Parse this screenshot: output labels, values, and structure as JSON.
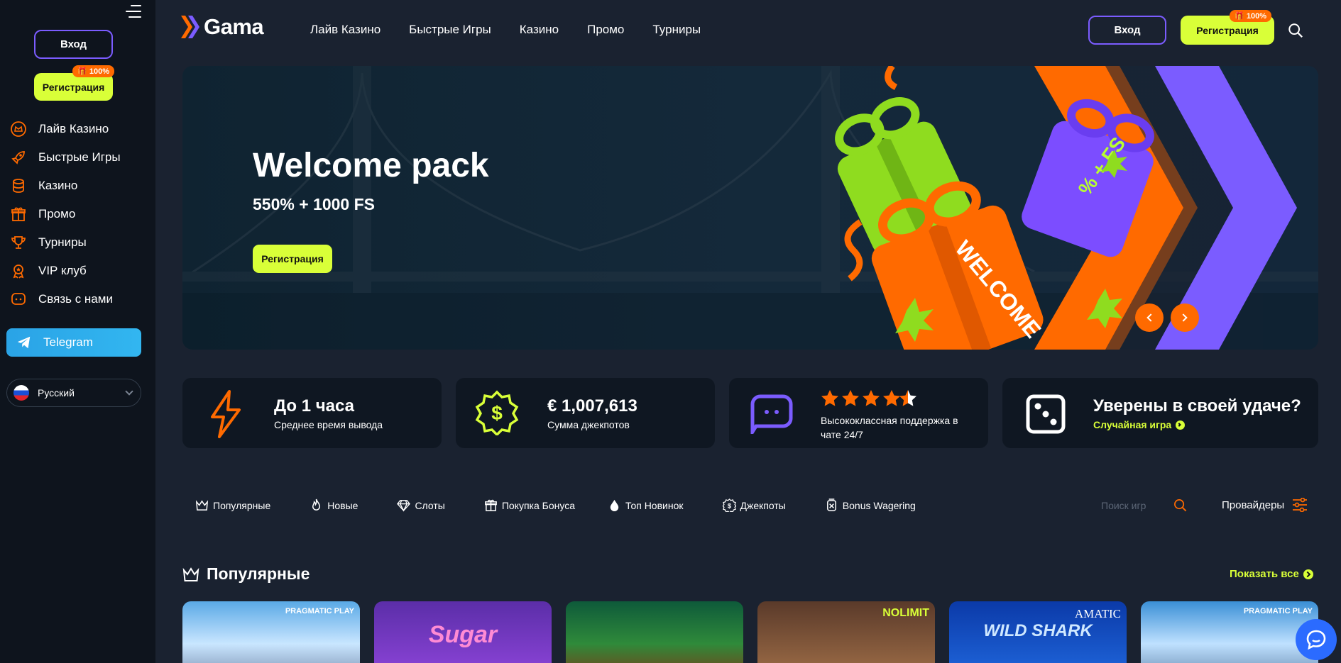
{
  "sidebar": {
    "login": "Вход",
    "register": "Регистрация",
    "register_badge": "🎁 100%",
    "items": [
      {
        "label": "Лайв Казино",
        "icon": "crown-circle-icon"
      },
      {
        "label": "Быстрые Игры",
        "icon": "rocket-icon"
      },
      {
        "label": "Казино",
        "icon": "coins-stack-icon"
      },
      {
        "label": "Промо",
        "icon": "gift-icon"
      },
      {
        "label": "Турниры",
        "icon": "trophy-icon"
      },
      {
        "label": "VIP клуб",
        "icon": "medal-icon"
      },
      {
        "label": "Связь с нами",
        "icon": "chat-icon"
      }
    ],
    "telegram": "Telegram",
    "language": "Русский"
  },
  "header": {
    "logo": "Gama",
    "nav": [
      "Лайв Казино",
      "Быстрые Игры",
      "Казино",
      "Промо",
      "Турниры"
    ],
    "login": "Вход",
    "register": "Регистрация",
    "register_badge": "🎁 100%"
  },
  "banner": {
    "title": "Welcome pack",
    "subtitle": "550% + 1000 FS",
    "button": "Регистрация",
    "gift_orange_text": "WELCOME",
    "gift_purple_text": "% + FS"
  },
  "cards": [
    {
      "title": "До 1 часа",
      "subtitle": "Среднее время вывода",
      "icon": "lightning-icon"
    },
    {
      "title": "€ 1,007,613",
      "subtitle": "Сумма джекпотов",
      "icon": "dollar-badge-icon"
    },
    {
      "rating": 4.5,
      "subtitle": "Высококлассная поддержка в чате 24/7",
      "icon": "chat-bubble-icon"
    },
    {
      "title": "Уверены в своей удаче?",
      "link": "Случайная игра",
      "icon": "dice-icon"
    }
  ],
  "filters": [
    {
      "label": "Популярные",
      "icon": "crown-icon"
    },
    {
      "label": "Новые",
      "icon": "flame-icon"
    },
    {
      "label": "Слоты",
      "icon": "diamond-icon"
    },
    {
      "label": "Покупка Бонуса",
      "icon": "gift-icon"
    },
    {
      "label": "Топ Новинок",
      "icon": "drop-icon"
    },
    {
      "label": "Джекпоты",
      "icon": "coin-icon"
    },
    {
      "label": "Bonus Wagering",
      "icon": "bonus-icon"
    }
  ],
  "search_placeholder": "Поиск игр",
  "providers": "Провайдеры",
  "popular": {
    "title": "Популярные",
    "show_all": "Показать все",
    "games": [
      {
        "provider": "PRAGMATIC PLAY",
        "name": ""
      },
      {
        "provider": "",
        "name": "Sugar"
      },
      {
        "provider": "",
        "name": ""
      },
      {
        "provider": "NOLIMIT",
        "name": ""
      },
      {
        "provider": "AMATIC",
        "name": "WILD SHARK"
      },
      {
        "provider": "PRAGMATIC PLAY",
        "name": ""
      }
    ]
  },
  "colors": {
    "accent": "#d9ff38",
    "orange": "#ff6a00",
    "purple": "#7b5cff",
    "bg": "#1a2230"
  }
}
